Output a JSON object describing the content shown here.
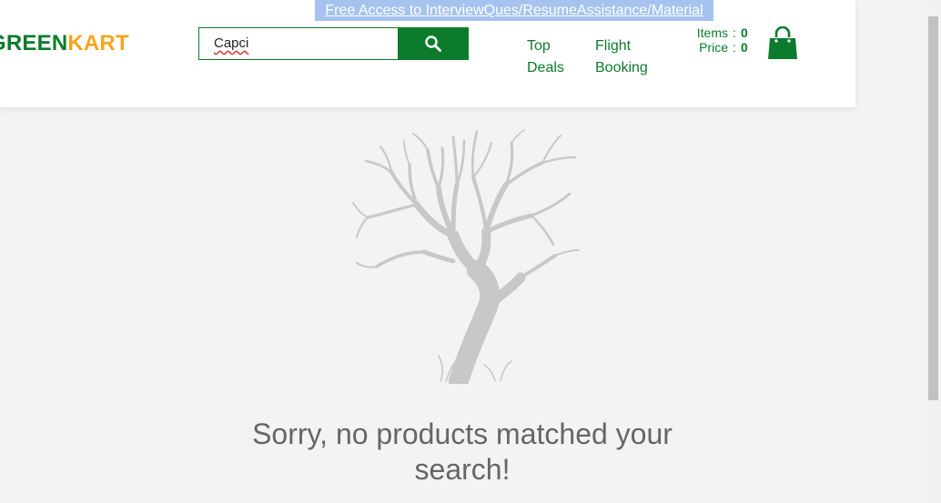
{
  "promo": {
    "text": "Free Access to InterviewQues/ResumeAssistance/Material"
  },
  "logo": {
    "part1": "GREEN",
    "part2": "KART"
  },
  "search": {
    "value": "Capci",
    "button_icon": "search-icon"
  },
  "nav": {
    "top_deals_line1": "Top",
    "top_deals_line2": "Deals",
    "flight_line1": "Flight",
    "flight_line2": "Booking"
  },
  "cart": {
    "items_label": "Items",
    "items_value": "0",
    "price_label": "Price",
    "price_value": "0",
    "colon": ":",
    "icon": "shopping-bag-icon"
  },
  "empty_state": {
    "illustration": "bare-tree",
    "message_line1": "Sorry, no products matched your",
    "message_line2": "search!"
  },
  "colors": {
    "brand_green": "#0c7b2b",
    "brand_orange": "#f7a51c",
    "promo_bg": "#a5c3ee",
    "tree_gray": "#c8c8c8",
    "message_gray": "#666666"
  }
}
